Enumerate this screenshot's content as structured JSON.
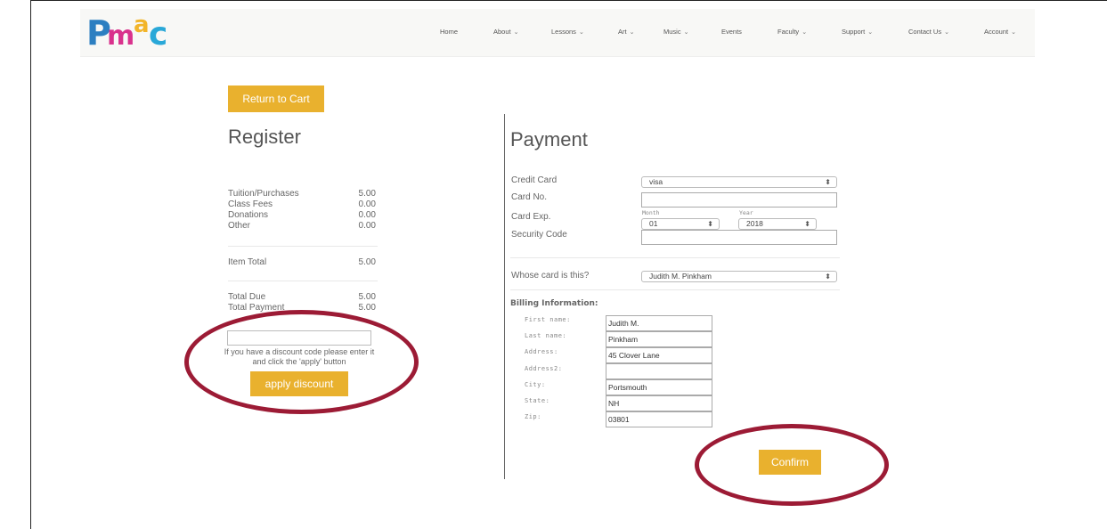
{
  "brand": {
    "logo_letters": [
      "P",
      "m",
      "a",
      "c"
    ],
    "logo_colors": [
      "#2d7fc1",
      "#d9328d",
      "#f2b52a",
      "#2aa8d8"
    ]
  },
  "nav": {
    "items": [
      {
        "label": "Home",
        "dropdown": false
      },
      {
        "label": "About",
        "dropdown": true
      },
      {
        "label": "Lessons",
        "dropdown": true
      },
      {
        "label": "Art",
        "dropdown": true
      },
      {
        "label": "Music",
        "dropdown": true
      },
      {
        "label": "Events",
        "dropdown": false
      },
      {
        "label": "Faculty",
        "dropdown": true
      },
      {
        "label": "Support",
        "dropdown": true
      },
      {
        "label": "Contact Us",
        "dropdown": true
      },
      {
        "label": "Account",
        "dropdown": true
      }
    ],
    "chevron": "⌄"
  },
  "register": {
    "return_button": "Return to Cart",
    "title": "Register",
    "lines": [
      {
        "label": "Tuition/Purchases",
        "value": "5.00"
      },
      {
        "label": "Class Fees",
        "value": "0.00"
      },
      {
        "label": "Donations",
        "value": "0.00"
      },
      {
        "label": "Other",
        "value": "0.00"
      }
    ],
    "item_total": {
      "label": "Item Total",
      "value": "5.00"
    },
    "total_due": {
      "label": "Total Due",
      "value": "5.00"
    },
    "total_payment": {
      "label": "Total Payment",
      "value": "5.00"
    },
    "discount_value": "",
    "discount_help": "If you have a discount code please enter it and click the 'apply' button",
    "apply_button": "apply discount"
  },
  "payment": {
    "title": "Payment",
    "credit_card": {
      "label": "Credit Card",
      "selected": "visa"
    },
    "card_no": {
      "label": "Card No.",
      "value": ""
    },
    "card_exp": {
      "label": "Card Exp.",
      "month_caption": "Month",
      "month": "01",
      "year_caption": "Year",
      "year": "2018"
    },
    "security_code": {
      "label": "Security Code",
      "value": ""
    },
    "whose_card": {
      "label": "Whose card is this?",
      "selected": "Judith M. Pinkham"
    },
    "select_arrows": "⬍"
  },
  "billing": {
    "title": "Billing Information:",
    "fields": [
      {
        "label": "First name:",
        "value": "Judith M."
      },
      {
        "label": "Last name:",
        "value": "Pinkham"
      },
      {
        "label": "Address:",
        "value": "45 Clover Lane"
      },
      {
        "label": "Address2:",
        "value": ""
      },
      {
        "label": "City:",
        "value": "Portsmouth"
      },
      {
        "label": "State:",
        "value": "NH"
      },
      {
        "label": "Zip:",
        "value": "03801"
      }
    ],
    "confirm_button": "Confirm"
  },
  "colors": {
    "accent": "#e9b12e",
    "highlight": "#9c1b35"
  }
}
